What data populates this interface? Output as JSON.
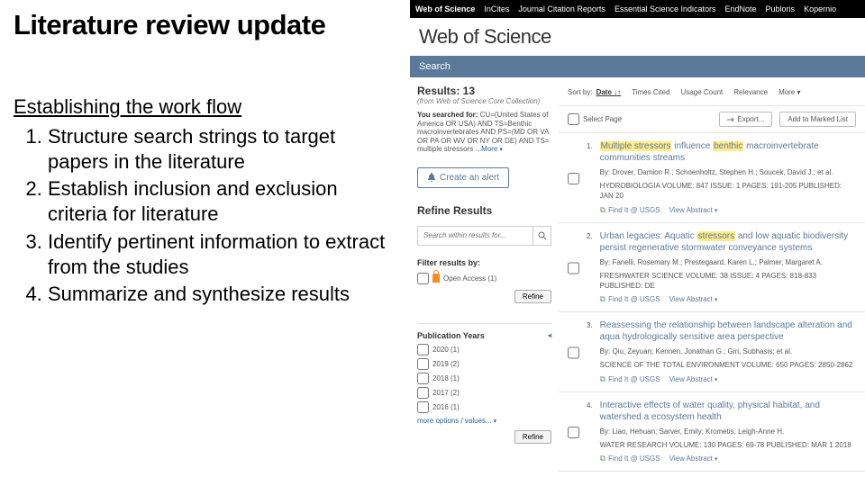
{
  "slide": {
    "title": "Literature review update",
    "subtitle": "Establishing the work flow",
    "steps": [
      "Structure search strings to target papers in the literature",
      "Establish inclusion and exclusion criteria for literature",
      "Identify pertinent information to extract from the studies",
      "Summarize and synthesize results"
    ]
  },
  "topnav": [
    "Web of Science",
    "InCites",
    "Journal Citation Reports",
    "Essential Science Indicators",
    "EndNote",
    "Publons",
    "Kopernio"
  ],
  "logo": "Web of Science",
  "searchTab": "Search",
  "results": {
    "count": "Results: 13",
    "sub": "(from Web of Science Core Collection)",
    "queryLabel": "You searched for:",
    "queryText": "CU=(United States of America OR USA) AND TS=Benthic macroinvertebrates AND PS=(MD OR VA OR PA OR WV OR NY OR DE) AND TS= multiple stressors",
    "moreLabel": "...More"
  },
  "alertBtn": "Create an alert",
  "refineHdr": "Refine Results",
  "searchWithin": "Search within results for...",
  "filterHdr": "Filter results by:",
  "openAccess": "Open Access (1)",
  "refineBtn": "Refine",
  "pubYearsHdr": "Publication Years",
  "years": [
    "2020 (1)",
    "2019 (2)",
    "2018 (1)",
    "2017 (2)",
    "2016 (1)"
  ],
  "moreOptions": "more options / values...",
  "sort": {
    "label": "Sort by:",
    "options": [
      "Date",
      "Times Cited",
      "Usage Count",
      "Relevance",
      "More"
    ]
  },
  "selectPage": "Select Page",
  "exportBtn": "Export...",
  "markedBtn": "Add to Marked List",
  "findIt": "Find It @ USGS",
  "viewAbs": "View Abstract",
  "itemsTitles": [
    [
      "Multiple stressors",
      " influence ",
      "benthic",
      " macroinvertebrate communities streams"
    ],
    [
      "Urban legacies: Aquatic ",
      "stressors",
      " and low aquatic biodiversity persist regenerative stormwater conveyance systems"
    ],
    [
      "Reassessing the relationship between landscape alteration and aqua hydrologically sensitive area perspective"
    ],
    [
      "Interactive effects of water quality, physical habitat, and watershed a ecosystem health"
    ]
  ],
  "itemsHL": [
    [
      0,
      2
    ],
    [
      1
    ],
    [],
    []
  ],
  "itemsBy": [
    "By: Drover, Damion R.; Schoenholtz, Stephen H.; Soucek, David J.; et al.",
    "By: Fanelli, Rosemary M.; Prestegaard, Karen L.; Palmer, Margaret A.",
    "By: Qiu, Zeyuan; Kennen, Jonathan G.; Giri, Subhasis; et al.",
    "By: Liao, Hehuan; Sarver, Emily; Krometis, Leigh-Anne H."
  ],
  "itemsSrc": [
    "HYDROBIOLOGIA   Volume: 847   Issue: 1   Pages: 191-205   Published: JAN 20",
    "FRESHWATER SCIENCE   Volume: 38   Issue: 4   Pages: 818-833   Published: DE",
    "SCIENCE OF THE TOTAL ENVIRONMENT   Volume: 650   Pages: 2850-2862",
    "WATER RESEARCH   Volume: 130   Pages: 69-78   Published: MAR 1 2018"
  ]
}
